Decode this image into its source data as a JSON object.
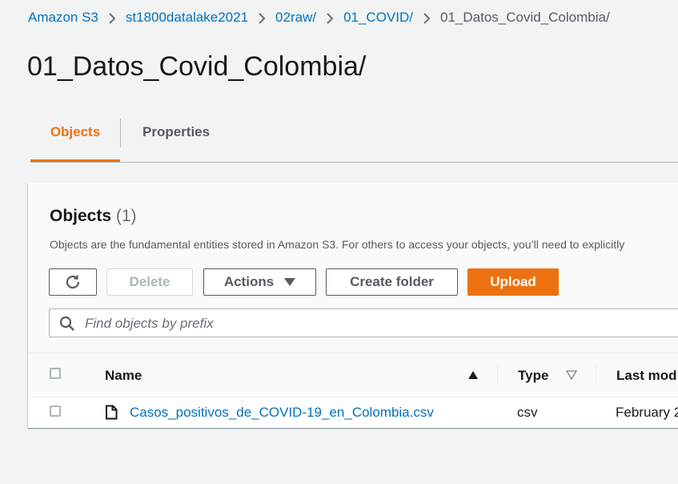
{
  "breadcrumb": {
    "items": [
      {
        "label": "Amazon S3"
      },
      {
        "label": "st1800datalake2021"
      },
      {
        "label": "02raw/"
      },
      {
        "label": "01_COVID/"
      }
    ],
    "current": "01_Datos_Covid_Colombia/"
  },
  "page": {
    "title": "01_Datos_Covid_Colombia/"
  },
  "tabs": [
    {
      "label": "Objects",
      "active": true
    },
    {
      "label": "Properties",
      "active": false
    }
  ],
  "objects_panel": {
    "title": "Objects",
    "count": "(1)",
    "description": "Objects are the fundamental entities stored in Amazon S3. For others to access your objects, you’ll need to explicitly"
  },
  "toolbar": {
    "refresh_icon": "refresh-icon",
    "delete_label": "Delete",
    "actions_label": "Actions",
    "create_folder_label": "Create folder",
    "upload_label": "Upload"
  },
  "search": {
    "placeholder": "Find objects by prefix",
    "value": ""
  },
  "table": {
    "columns": [
      {
        "label": "Name",
        "sort": "ascending"
      },
      {
        "label": "Type",
        "sort": "descending-inactive"
      },
      {
        "label": "Last mod"
      }
    ],
    "rows": [
      {
        "name": "Casos_positivos_de_COVID-19_en_Colombia.csv",
        "type": "csv",
        "last_modified": "February 2",
        "icon": "file-icon"
      }
    ]
  },
  "colors": {
    "accent": "#ec7211",
    "link": "#0073bb",
    "text": "#16191f",
    "muted": "#545b64"
  }
}
